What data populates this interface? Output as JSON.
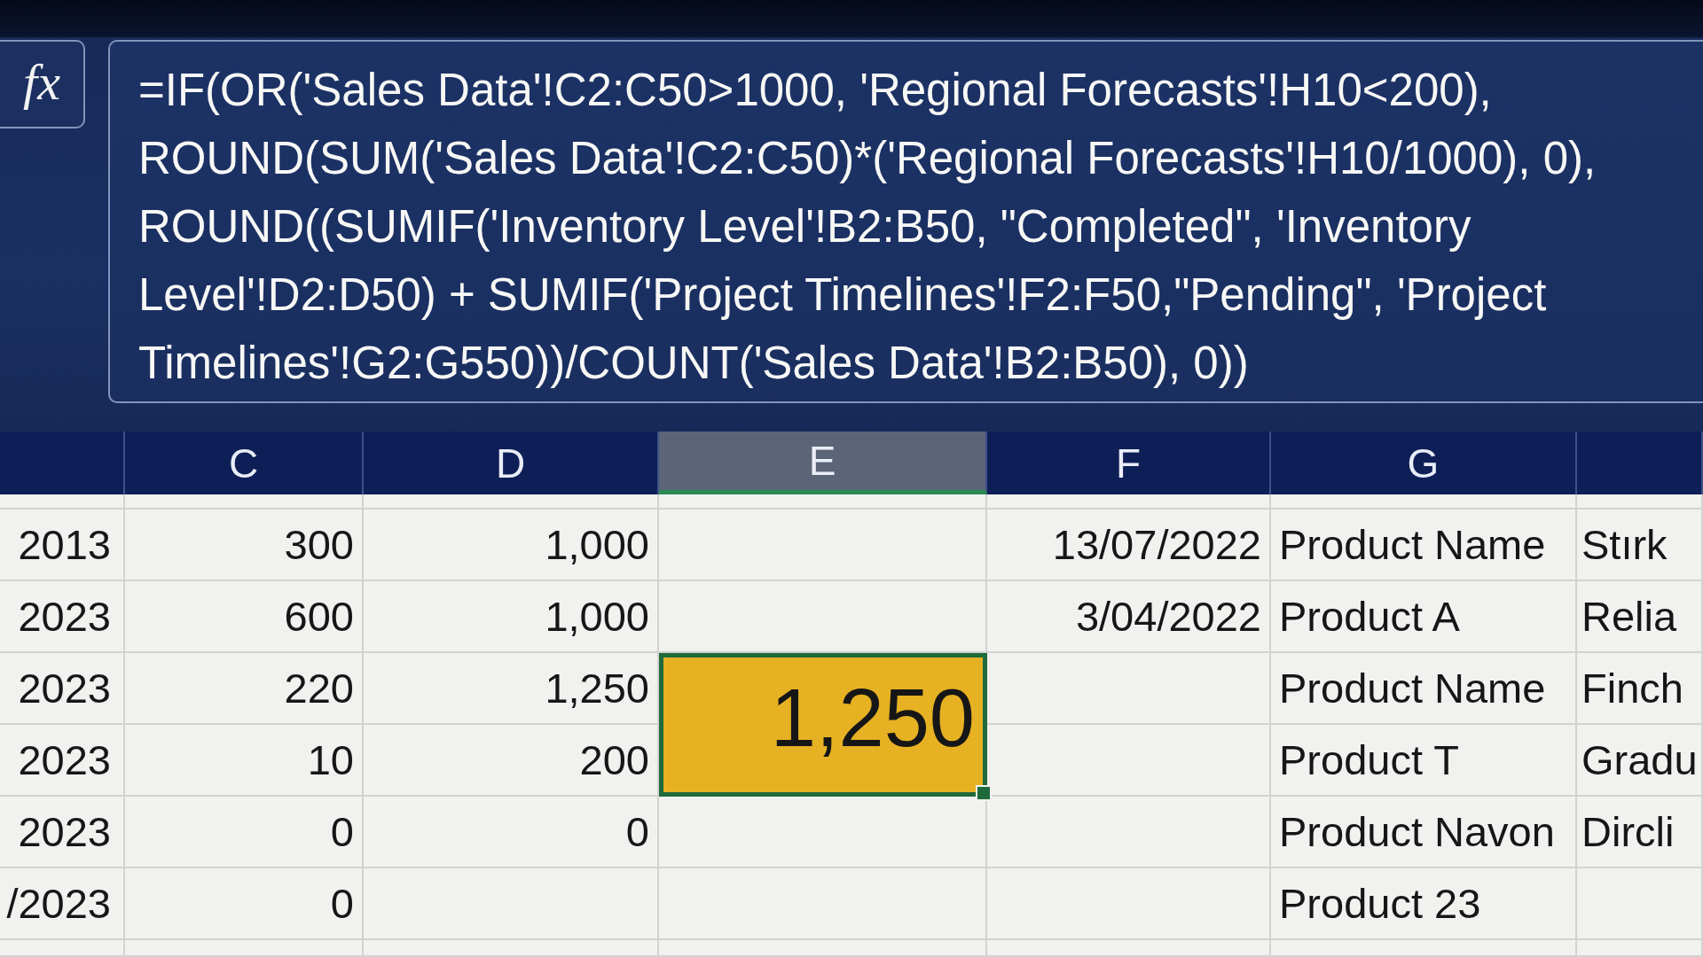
{
  "formula_bar": {
    "function_label": "fx",
    "formula": "=IF(OR('Sales Data'!C2:C50>1000, 'Regional Forecasts'!H10<200), ROUND(SUM('Sales Data'!C2:C50)*('Regional Forecasts'!H10/1000), 0), ROUND((SUMIF('Inventory Level'!B2:B50, \"Completed\", 'Inventory Level'!D2:D50) + SUMIF('Project Timelines'!F2:F50,\"Pending\", 'Project Timelines'!G2:G550))/COUNT('Sales Data'!B2:B50), 0))"
  },
  "sheet": {
    "columns": [
      {
        "kind": "numeric",
        "selected": false
      },
      {
        "label": "C",
        "kind": "numeric",
        "selected": false
      },
      {
        "label": "D",
        "kind": "numeric",
        "selected": false
      },
      {
        "label": "E",
        "kind": "numeric",
        "selected": true
      },
      {
        "label": "F",
        "kind": "numeric",
        "selected": false
      },
      {
        "label": "G",
        "kind": "text",
        "selected": false
      },
      {
        "kind": "text",
        "selected": false
      }
    ],
    "rows": [
      {
        "cells": [
          {
            "kind": "single",
            "text": "2013",
            "selected": false
          },
          {
            "kind": "single",
            "text": "300",
            "selected": false
          },
          {
            "kind": "single",
            "text": "1,000",
            "selected": false
          },
          {
            "kind": "single",
            "selected": false
          },
          {
            "kind": "single",
            "text": "13/07/2022",
            "selected": false
          },
          {
            "kind": "single",
            "text": "Product Name",
            "selected": false
          },
          {
            "kind": "single",
            "text": "Stırk",
            "selected": false
          }
        ]
      },
      {
        "cells": [
          {
            "kind": "single",
            "text": "2023",
            "selected": false
          },
          {
            "kind": "single",
            "text": "600",
            "selected": false
          },
          {
            "kind": "single",
            "text": "1,000",
            "selected": false
          },
          {
            "kind": "single",
            "selected": false
          },
          {
            "kind": "single",
            "text": "3/04/2022",
            "selected": false
          },
          {
            "kind": "single",
            "text": "Product A",
            "selected": false
          },
          {
            "kind": "single",
            "text": "Relia",
            "selected": false
          }
        ]
      },
      {
        "cells": [
          {
            "kind": "single",
            "text": "2023",
            "selected": false
          },
          {
            "kind": "single",
            "text": "220",
            "selected": false
          },
          {
            "kind": "single",
            "text": "1,250",
            "selected": false
          },
          {
            "kind": "merged",
            "text": "1,250",
            "selected": true,
            "color": "#e6b122"
          },
          {
            "kind": "single",
            "selected": false
          },
          {
            "kind": "single",
            "text": "Product Name",
            "selected": false
          },
          {
            "kind": "single",
            "text": "Finch",
            "selected": false
          }
        ]
      },
      {
        "cells": [
          {
            "kind": "single",
            "text": "2023",
            "selected": false
          },
          {
            "kind": "single",
            "text": "10",
            "selected": false
          },
          {
            "kind": "single",
            "text": "200",
            "selected": false
          },
          {
            "kind": "covered"
          },
          {
            "kind": "single",
            "selected": false
          },
          {
            "kind": "single",
            "text": "Product T",
            "selected": false
          },
          {
            "kind": "single",
            "text": "Gradu",
            "selected": false
          }
        ]
      },
      {
        "cells": [
          {
            "kind": "single",
            "text": "2023",
            "selected": false
          },
          {
            "kind": "single",
            "text": "0",
            "selected": false
          },
          {
            "kind": "single",
            "text": "0",
            "selected": false
          },
          {
            "kind": "single",
            "selected": false
          },
          {
            "kind": "single",
            "selected": false
          },
          {
            "kind": "single",
            "text": "Product Navon",
            "selected": false
          },
          {
            "kind": "single",
            "text": "Dircli",
            "selected": false
          }
        ]
      },
      {
        "cells": [
          {
            "kind": "single",
            "text": "/2023",
            "selected": false
          },
          {
            "kind": "single",
            "text": "0",
            "selected": false
          },
          {
            "kind": "single",
            "selected": false
          },
          {
            "kind": "single",
            "selected": false
          },
          {
            "kind": "single",
            "selected": false
          },
          {
            "kind": "single",
            "text": "Product 23",
            "selected": false
          },
          {
            "kind": "single",
            "selected": false
          }
        ]
      }
    ]
  }
}
